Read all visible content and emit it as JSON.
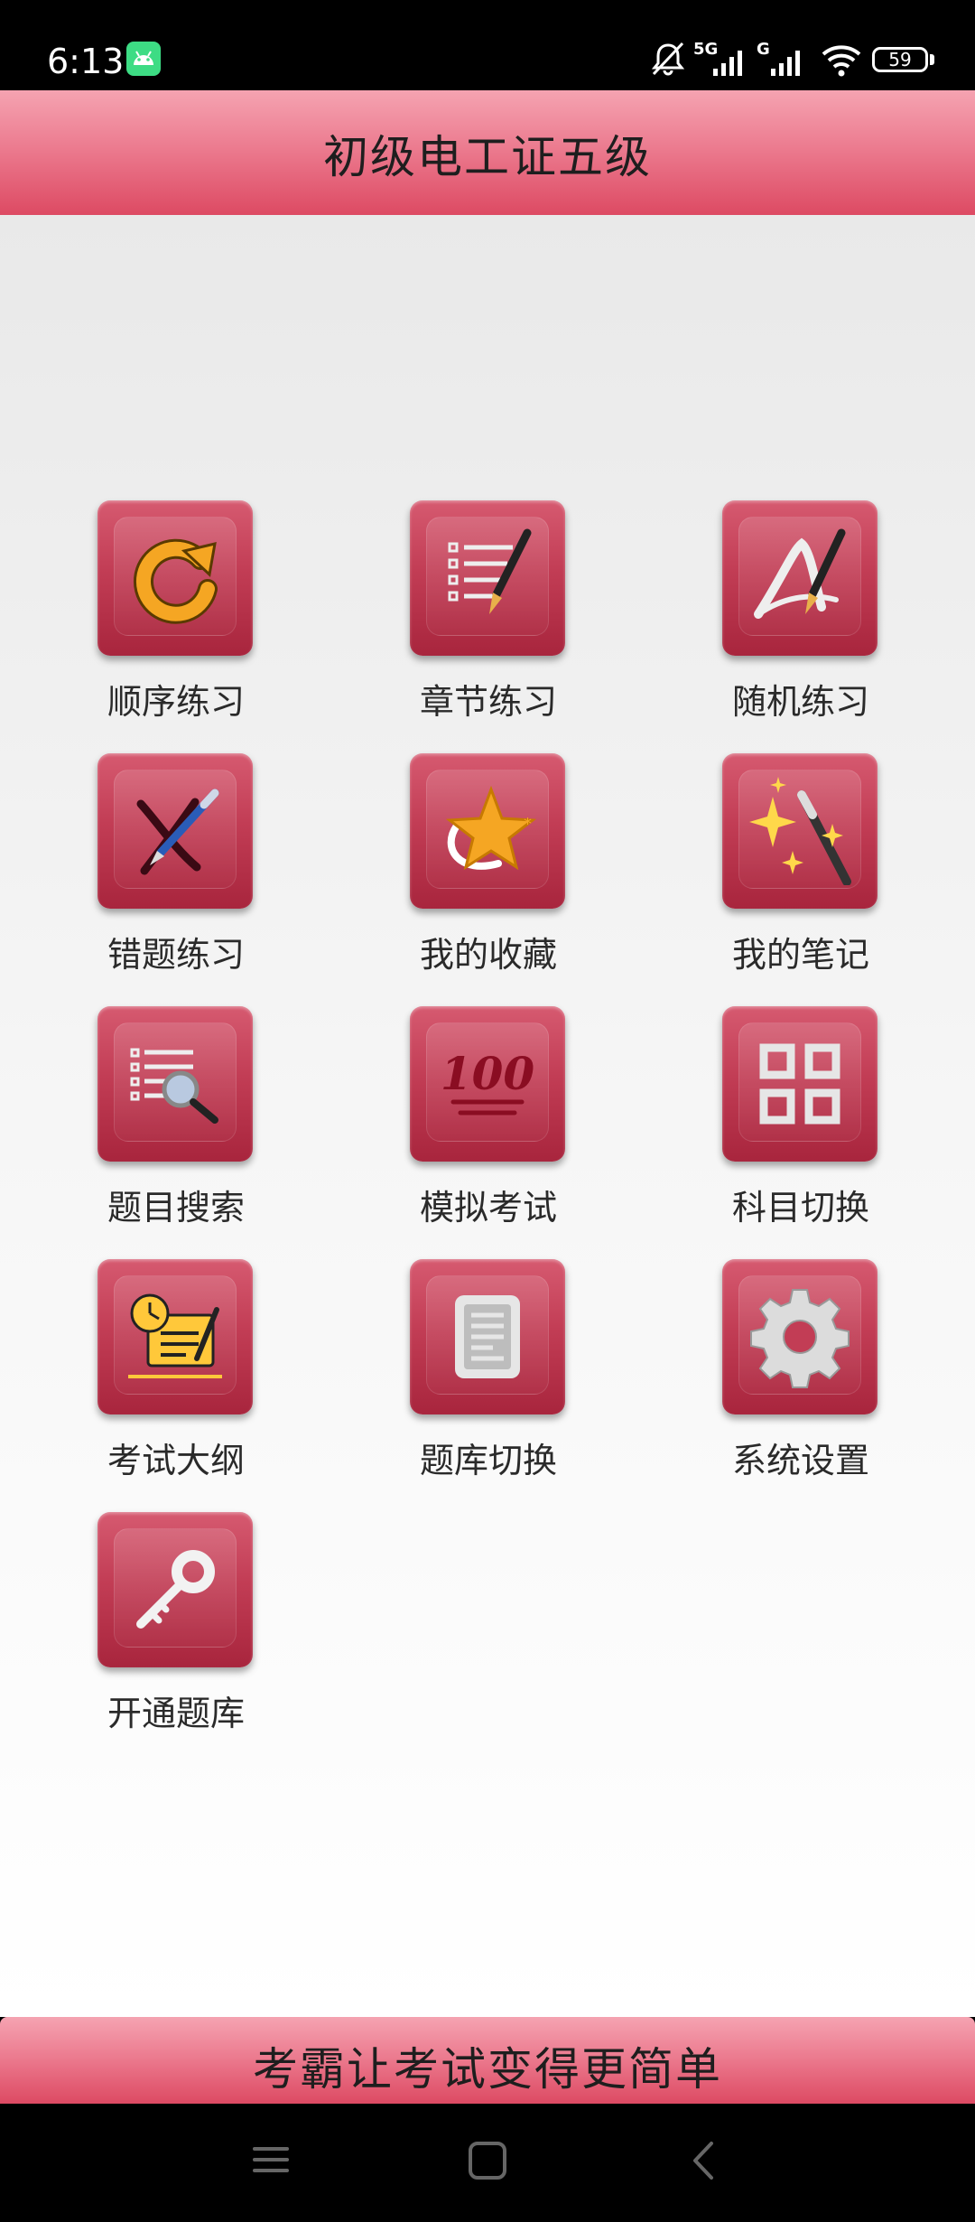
{
  "status_bar": {
    "time": "6:13",
    "network_1": "5G",
    "network_2": "G",
    "battery": "59",
    "icons": [
      "android-icon",
      "mute-bell-icon",
      "signal-icon",
      "wifi-icon",
      "battery-icon"
    ]
  },
  "header": {
    "title": "初级电工证五级"
  },
  "menu": {
    "items": [
      {
        "label": "顺序练习",
        "icon": "refresh-arrow-icon"
      },
      {
        "label": "章节练习",
        "icon": "list-pen-icon"
      },
      {
        "label": "随机练习",
        "icon": "random-pen-icon"
      },
      {
        "label": "错题练习",
        "icon": "wrong-pen-icon"
      },
      {
        "label": "我的收藏",
        "icon": "star-icon"
      },
      {
        "label": "我的笔记",
        "icon": "magic-wand-icon"
      },
      {
        "label": "题目搜索",
        "icon": "search-list-icon"
      },
      {
        "label": "模拟考试",
        "icon": "hundred-icon"
      },
      {
        "label": "科目切换",
        "icon": "grid-icon"
      },
      {
        "label": "考试大纲",
        "icon": "outline-clock-icon"
      },
      {
        "label": "题库切换",
        "icon": "document-icon"
      },
      {
        "label": "系统设置",
        "icon": "gear-icon"
      },
      {
        "label": "开通题库",
        "icon": "key-icon"
      }
    ]
  },
  "footer": {
    "slogan": "考霸让考试变得更简单"
  },
  "colors": {
    "header_top": "#f5a3b1",
    "header_bottom": "#dd4a63",
    "tile_top": "#d65a70",
    "tile_bottom": "#a8253d",
    "icon_gold": "#f5a623"
  }
}
